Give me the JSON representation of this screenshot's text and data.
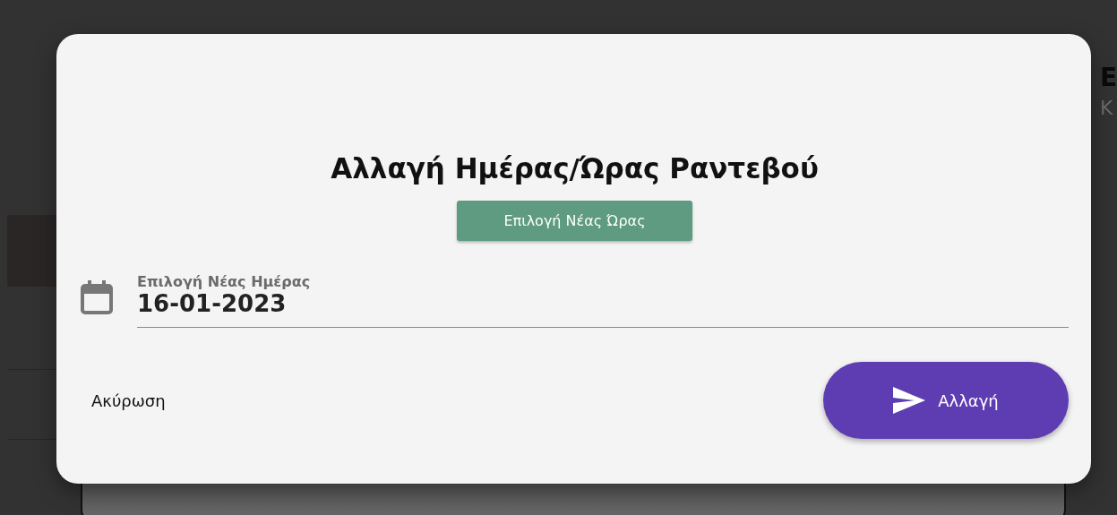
{
  "background": {
    "heading_fragment": "Ε",
    "subtitle_fragment": "Κ"
  },
  "dialog": {
    "title": "Αλλαγή Ημέρας/Ώρας Ραντεβού",
    "time_button": "Επιλογή Νέας Ώρας",
    "date_field": {
      "label": "Επιλογή Νέας Ημέρας",
      "value": "16-01-2023"
    },
    "cancel_button": "Ακύρωση",
    "submit_button": "Αλλαγή"
  }
}
